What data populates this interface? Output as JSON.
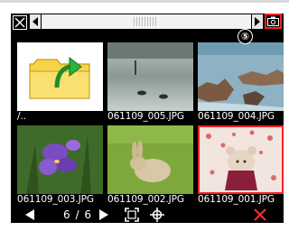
{
  "top_bar": {
    "close_icon": "close-box-icon",
    "prev_icon": "triangle-left-icon",
    "next_icon": "triangle-right-icon",
    "camera_icon": "camera-icon",
    "camera_highlight_color": "#ff2020"
  },
  "callout": {
    "label": "⑤"
  },
  "thumbnails": [
    {
      "caption": "/..",
      "kind": "parent-folder"
    },
    {
      "caption": "061109_005.JPG",
      "kind": "photo-ducks"
    },
    {
      "caption": "061109_004.JPG",
      "kind": "photo-rocks"
    },
    {
      "caption": "061109_003.JPG",
      "kind": "photo-iris"
    },
    {
      "caption": "061109_002.JPG",
      "kind": "photo-rabbit"
    },
    {
      "caption": "061109_001.JPG",
      "kind": "photo-teddy-bear",
      "selected": true
    }
  ],
  "bottom_bar": {
    "page_text": "6 / 6",
    "prev_icon": "triangle-left-icon",
    "next_icon": "triangle-right-icon",
    "fit_icon": "frame-corners-icon",
    "move_icon": "crosshair-icon",
    "delete_icon": "red-x-icon",
    "delete_color": "#ff2a2a"
  },
  "colors": {
    "screen_bg": "#000000",
    "selection": "#ff2020"
  }
}
